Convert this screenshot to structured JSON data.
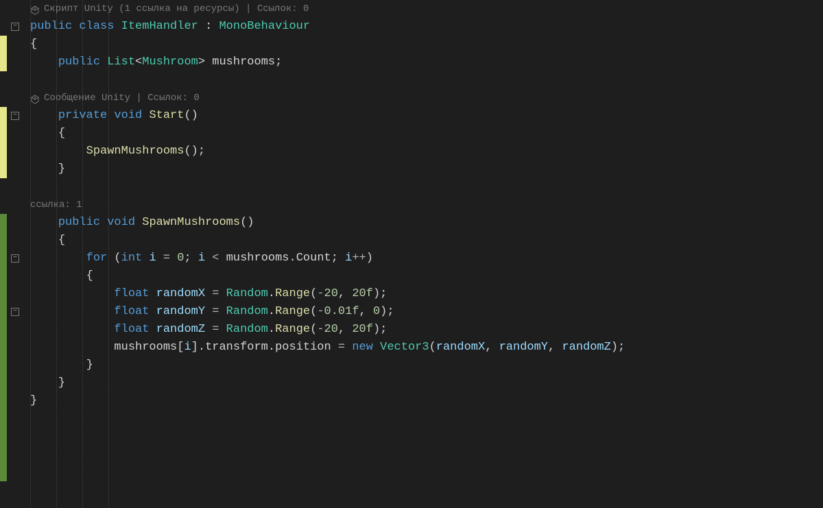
{
  "codelens": {
    "class": "Скрипт Unity (1 ссылка на ресурсы) | Ссылок: 0",
    "start": "Сообщение Unity | Ссылок: 0",
    "spawn": "ссылка: 1"
  },
  "code": {
    "l1": {
      "public": "public",
      "class": "class",
      "name": "ItemHandler",
      "colon": ":",
      "base": "MonoBehaviour"
    },
    "l2": "{",
    "l3": {
      "public": "public",
      "list": "List",
      "lt": "<",
      "mtype": "Mushroom",
      "gt": ">",
      "field": "mushrooms",
      "semi": ";"
    },
    "l5": {
      "private": "private",
      "void": "void",
      "name": "Start",
      "parens": "()"
    },
    "l6": "{",
    "l7": {
      "call": "SpawnMushrooms",
      "parens": "();"
    },
    "l8": "}",
    "l10": {
      "public": "public",
      "void": "void",
      "name": "SpawnMushrooms",
      "parens": "()"
    },
    "l11": "{",
    "l12": {
      "for": "for",
      "open": " (",
      "int": "int",
      "i": "i",
      "eq": " = ",
      "zero": "0",
      "semi1": "; ",
      "i2": "i",
      "lt": " < ",
      "mush": "mushrooms",
      "dot": ".",
      "count": "Count",
      "semi2": "; ",
      "i3": "i",
      "inc": "++",
      "close": ")"
    },
    "l13": "{",
    "l14": {
      "float": "float",
      "var": "randomX",
      "eq": " = ",
      "rand": "Random",
      "dot": ".",
      "range": "Range",
      "open": "(",
      "a": "-",
      "n1": "20",
      "comma": ", ",
      "n2": "20f",
      "close": ");"
    },
    "l15": {
      "float": "float",
      "var": "randomY",
      "eq": " = ",
      "rand": "Random",
      "dot": ".",
      "range": "Range",
      "open": "(",
      "a": "-",
      "n1": "0.01f",
      "comma": ", ",
      "n2": "0",
      "close": ");"
    },
    "l16": {
      "float": "float",
      "var": "randomZ",
      "eq": " = ",
      "rand": "Random",
      "dot": ".",
      "range": "Range",
      "open": "(",
      "a": "-",
      "n1": "20",
      "comma": ", ",
      "n2": "20f",
      "close": ");"
    },
    "l17": {
      "mush": "mushrooms",
      "open": "[",
      "i": "i",
      "close": "].",
      "transform": "transform",
      "dot": ".",
      "pos": "position",
      "eq": " = ",
      "new": "new",
      "vec": "Vector3",
      "popen": "(",
      "x": "randomX",
      "c1": ", ",
      "y": "randomY",
      "c2": ", ",
      "z": "randomZ",
      "pclose": ");"
    },
    "l18": "}",
    "l19": "}",
    "l20": "}"
  }
}
